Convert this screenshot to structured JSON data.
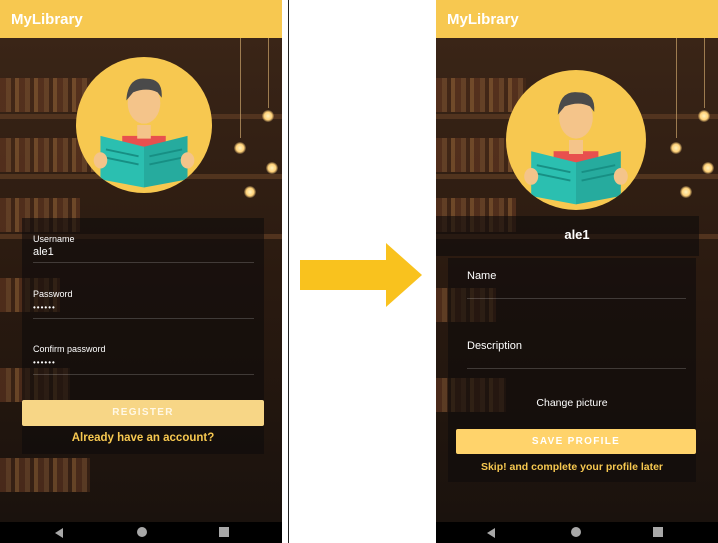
{
  "app": {
    "title": "MyLibrary"
  },
  "register_screen": {
    "username_label": "Username",
    "username_value": "ale1",
    "password_label": "Password",
    "password_value": "••••••",
    "confirm_label": "Confirm password",
    "confirm_value": "••••••",
    "register_button": "REGISTER",
    "login_link": "Already have an account?"
  },
  "profile_screen": {
    "username": "ale1",
    "name_label": "Name",
    "description_label": "Description",
    "change_picture": "Change picture",
    "save_button": "SAVE PROFILE",
    "skip_link": "Skip! and complete your profile later"
  },
  "colors": {
    "accent": "#f7c850",
    "button": "#ffd36b",
    "arrow": "#f9c21e",
    "book": "#2bbfb0",
    "shirt": "#e8504e"
  },
  "icons": [
    "person-reading-avatar",
    "back-triangle-icon",
    "home-circle-icon",
    "recent-square-icon",
    "right-arrow-icon"
  ]
}
